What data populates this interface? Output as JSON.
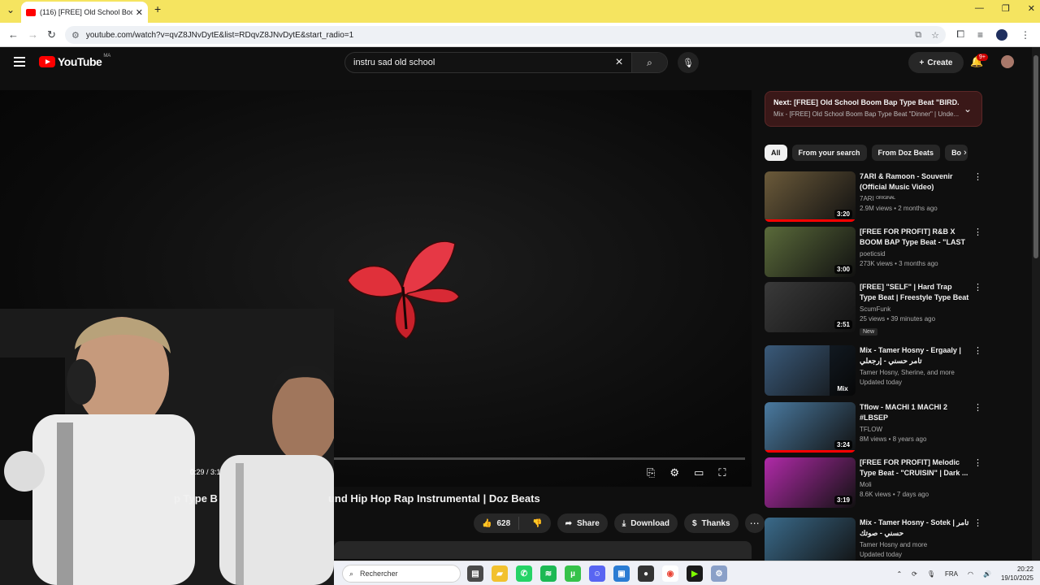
{
  "browser": {
    "tab_title": "(116) [FREE] Old School Boom Bap Type Beat",
    "url": "youtube.com/watch?v=qvZ8JNvDytE&list=RDqvZ8JNvDytE&start_radio=1"
  },
  "masthead": {
    "logo_text": "YouTube",
    "country_code": "MA",
    "search_query": "instru sad old school",
    "create_label": "Create",
    "notification_count": "9+"
  },
  "player": {
    "time": "0:29 / 3:1",
    "progress_fraction": 0.26
  },
  "video": {
    "title_visible_left": "p Type B",
    "title_visible_right": "und Hip Hop Rap Instrumental | Doz Beats",
    "like_count": "628",
    "share_label": "Share",
    "download_label": "Download",
    "thanks_label": "Thanks"
  },
  "sidebar": {
    "next_prefix": "Next:",
    "next_title": "[FREE] Old School Boom Bap Type Beat \"BIRD...",
    "next_subtitle": "Mix - [FREE] Old School Boom Bap Type Beat \"Dinner\" | Unde...",
    "chips": [
      "All",
      "From your search",
      "From Doz Beats",
      "Bo"
    ],
    "recs": [
      {
        "title": "7ARI & Ramoon - Souvenir (Official Music Video)",
        "channel": "7ARI ᴼᴿᴵᴳᴵᴺᴬᴸ",
        "stats": "2.9M views • 2 months ago",
        "duration": "3:20",
        "badge": "",
        "watched": 1.0,
        "color": "#6b5a3a"
      },
      {
        "title": "[FREE FOR PROFIT] R&B X BOOM BAP Type Beat - \"LAST ...",
        "channel": "poeticsid",
        "stats": "273K views • 3 months ago",
        "duration": "3:00",
        "badge": "",
        "watched": 0,
        "color": "#5a6a3a"
      },
      {
        "title": "[FREE] \"SELF\" | Hard Trap Type Beat | Freestyle Type Beat | Fre...",
        "channel": "ScumFunk",
        "stats": "25 views • 39 minutes ago",
        "duration": "2:51",
        "badge": "New",
        "watched": 0,
        "color": "#3a3a3a"
      },
      {
        "title": "Mix - Tamer Hosny - Ergaaly | تامر حسني - إرجعلي",
        "channel": "Tamer Hosny, Sherine, and more",
        "stats": "Updated today",
        "duration": "Mix",
        "badge": "",
        "watched": 0,
        "color": "#3a5a7a"
      },
      {
        "title": "Tflow - MACHI 1 MACHI 2 #LBSEP",
        "channel": "TFLOW",
        "stats": "8M views • 8 years ago",
        "duration": "3:24",
        "badge": "",
        "watched": 1.0,
        "color": "#4a7aa0"
      },
      {
        "title": "[FREE FOR PROFIT] Melodic Type Beat - \"CRUISIN\" | Dark ...",
        "channel": "Moli",
        "stats": "8.6K views • 7 days ago",
        "duration": "3:19",
        "badge": "",
        "watched": 0,
        "color": "#b02aa8"
      },
      {
        "title": "Mix - Tamer Hosny - Sotek | تامر حسني - صوتك",
        "channel": "Tamer Hosny and more",
        "stats": "Updated today",
        "duration": "",
        "badge": "",
        "watched": 0,
        "color": "#3a6a8a"
      }
    ]
  },
  "taskbar": {
    "search_placeholder": "Rechercher",
    "lang": "FRA",
    "time": "20:22",
    "date": "19/10/2025"
  }
}
